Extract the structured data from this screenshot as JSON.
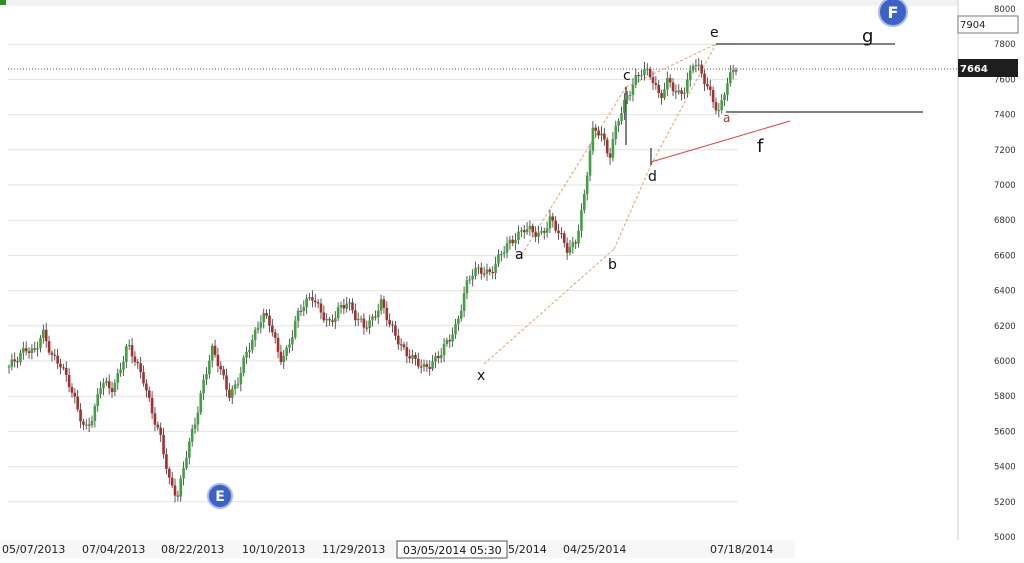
{
  "chart_data": {
    "type": "candlestick",
    "y_ticks": [
      5000,
      5200,
      5400,
      5600,
      5800,
      6000,
      6200,
      6400,
      6600,
      6800,
      7000,
      7200,
      7400,
      7600,
      7800,
      8000
    ],
    "ylim": [
      5000,
      8000
    ],
    "x_dates": [
      "05/07/2013",
      "07/04/2013",
      "08/22/2013",
      "10/10/2013",
      "11/29/2013",
      "03/05/2014 05:30",
      "5/2014",
      "04/25/2014",
      "07/18/2014"
    ],
    "grid": true,
    "price_boxes": [
      {
        "value": "7904",
        "highlight": false
      },
      {
        "value": "7664",
        "highlight": true
      }
    ],
    "badges": [
      "E",
      "F"
    ],
    "wave_labels": [
      "x",
      "a",
      "b",
      "c",
      "d",
      "e",
      "a",
      "f",
      "g"
    ],
    "approx_series": [
      [
        5968,
        6000,
        6080,
        6060,
        6150,
        6030,
        6005,
        5880,
        5730,
        5620,
        5700,
        5880,
        5835,
        5935,
        6080,
        5990,
        5900,
        5690,
        5540,
        5320,
        5240,
        5460,
        5650,
        5890,
        6060,
        5950,
        5820,
        5870,
        6020,
        6150,
        6280,
        6190,
        6005,
        6080,
        6240,
        6320,
        6380,
        6270,
        6190,
        6300,
        6350,
        6240,
        6190,
        6250,
        6330,
        6200,
        6130,
        6050,
        5990,
        5960,
        6000,
        6030,
        6110,
        6220,
        6420,
        6500,
        6520,
        6510,
        6580,
        6660,
        6720,
        6750,
        6720,
        6730,
        6810,
        6720,
        6640,
        6680,
        6900,
        7300,
        7320,
        7150,
        7350,
        7500,
        7600,
        7640,
        7620,
        7510,
        7590,
        7500,
        7560,
        7710,
        7610,
        7520,
        7420,
        7580,
        7664
      ]
    ]
  }
}
